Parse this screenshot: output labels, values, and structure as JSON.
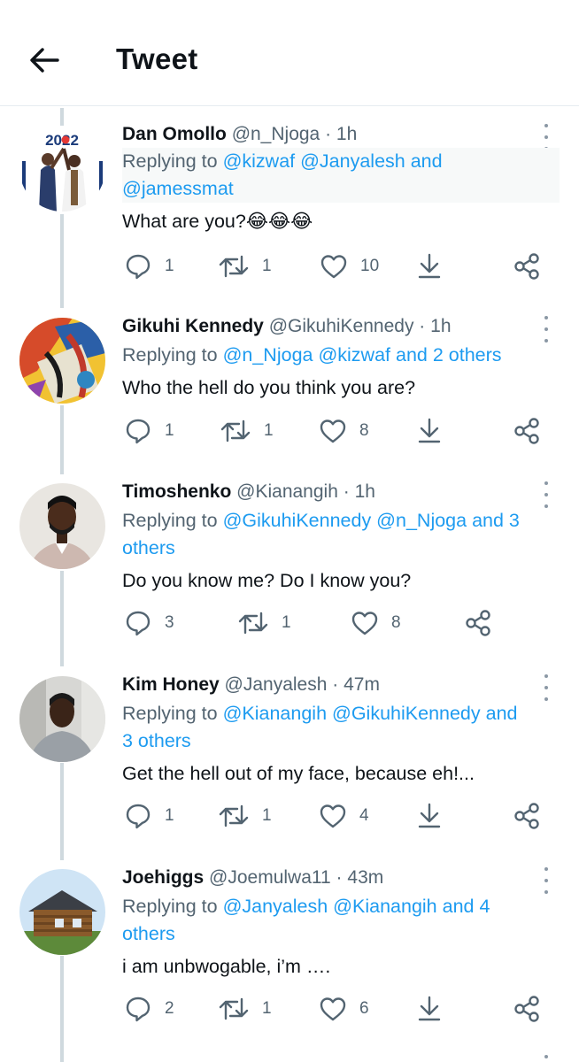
{
  "header": {
    "title": "Tweet",
    "back_icon": "arrow-left-icon"
  },
  "colors": {
    "mention": "#1d9bf0",
    "muted": "#536471",
    "text": "#0f1419",
    "icon": "#536471"
  },
  "tweets": [
    {
      "name": "Dan Omollo",
      "handle": "@n_Njoga",
      "time": "1h",
      "replying_prefix": "Replying to",
      "mentions_line1": "@kizwaf @Janyalesh and",
      "mentions_line2": "@jamessmat",
      "body": "What are you?😂😂😂",
      "replies": "1",
      "retweets": "1",
      "likes": "10",
      "avatar_badge": "2022"
    },
    {
      "name": "Gikuhi Kennedy",
      "handle": "@GikuhiKennedy",
      "time": "1h",
      "replying_prefix": "Replying to",
      "mentions_line1": "@n_Njoga @kizwaf and 2 others",
      "body": "Who the hell do you think you are?",
      "replies": "1",
      "retweets": "1",
      "likes": "8"
    },
    {
      "name": "Timoshenko",
      "handle": "@Kianangih",
      "time": "1h",
      "replying_prefix": "Replying to",
      "mentions_line1": "@GikuhiKennedy @n_Njoga and 3",
      "mentions_line2": "others",
      "body": "Do you know me? Do I know you?",
      "replies": "3",
      "retweets": "1",
      "likes": "8"
    },
    {
      "name": "Kim Honey",
      "handle": "@Janyalesh",
      "time": "47m",
      "replying_prefix": "Replying to",
      "mentions_line1": "@Kianangih @GikuhiKennedy and",
      "mentions_line2": "3 others",
      "body": "Get the hell out of my face, because eh!...",
      "replies": "1",
      "retweets": "1",
      "likes": "4"
    },
    {
      "name": "Joehiggs",
      "handle": "@Joemulwa11",
      "time": "43m",
      "replying_prefix": "Replying to",
      "mentions_line1": "@Janyalesh @Kianangih and 4",
      "mentions_line2": "others",
      "body": "i am unbwogable, i’m ….",
      "replies": "2",
      "retweets": "1",
      "likes": "6"
    }
  ]
}
